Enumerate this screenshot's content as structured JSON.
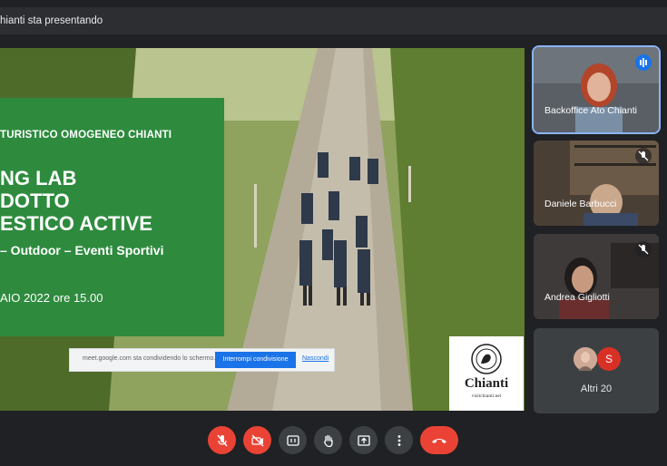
{
  "topbar": {
    "title": "hianti sta presentando"
  },
  "slide": {
    "line1": "TURISTICO OMOGENEO CHIANTI",
    "line2": "NG LAB",
    "line3": "DOTTO",
    "line4": "ESTICO ACTIVE",
    "line5": "– Outdoor – Eventi Sportivi",
    "line6": "AIO 2022 ore 15.00"
  },
  "logo": {
    "name": "Chianti",
    "url": "visitchianti.net"
  },
  "sharebar": {
    "message": "meet.google.com sta condividendo lo schermo.",
    "stop_label": "Interrompi condivisione",
    "hide_label": "Nascondi"
  },
  "participants": [
    {
      "name": "Backoffice Ato Chianti",
      "mic": "speaking",
      "active": true
    },
    {
      "name": "Daniele Barbucci",
      "mic": "muted"
    },
    {
      "name": "Andrea Gigliotti",
      "mic": "muted"
    }
  ],
  "others": {
    "label": "Altri 20",
    "avatar_letter": "S",
    "avatar_color": "#d93025"
  },
  "colors": {
    "accent": "#8ab4f8",
    "danger": "#ea4335",
    "slide_green": "#2e8b3e"
  },
  "controls": [
    "mic-off-icon",
    "camera-off-icon",
    "captions-icon",
    "raise-hand-icon",
    "present-icon",
    "more-icon",
    "end-call-icon"
  ]
}
